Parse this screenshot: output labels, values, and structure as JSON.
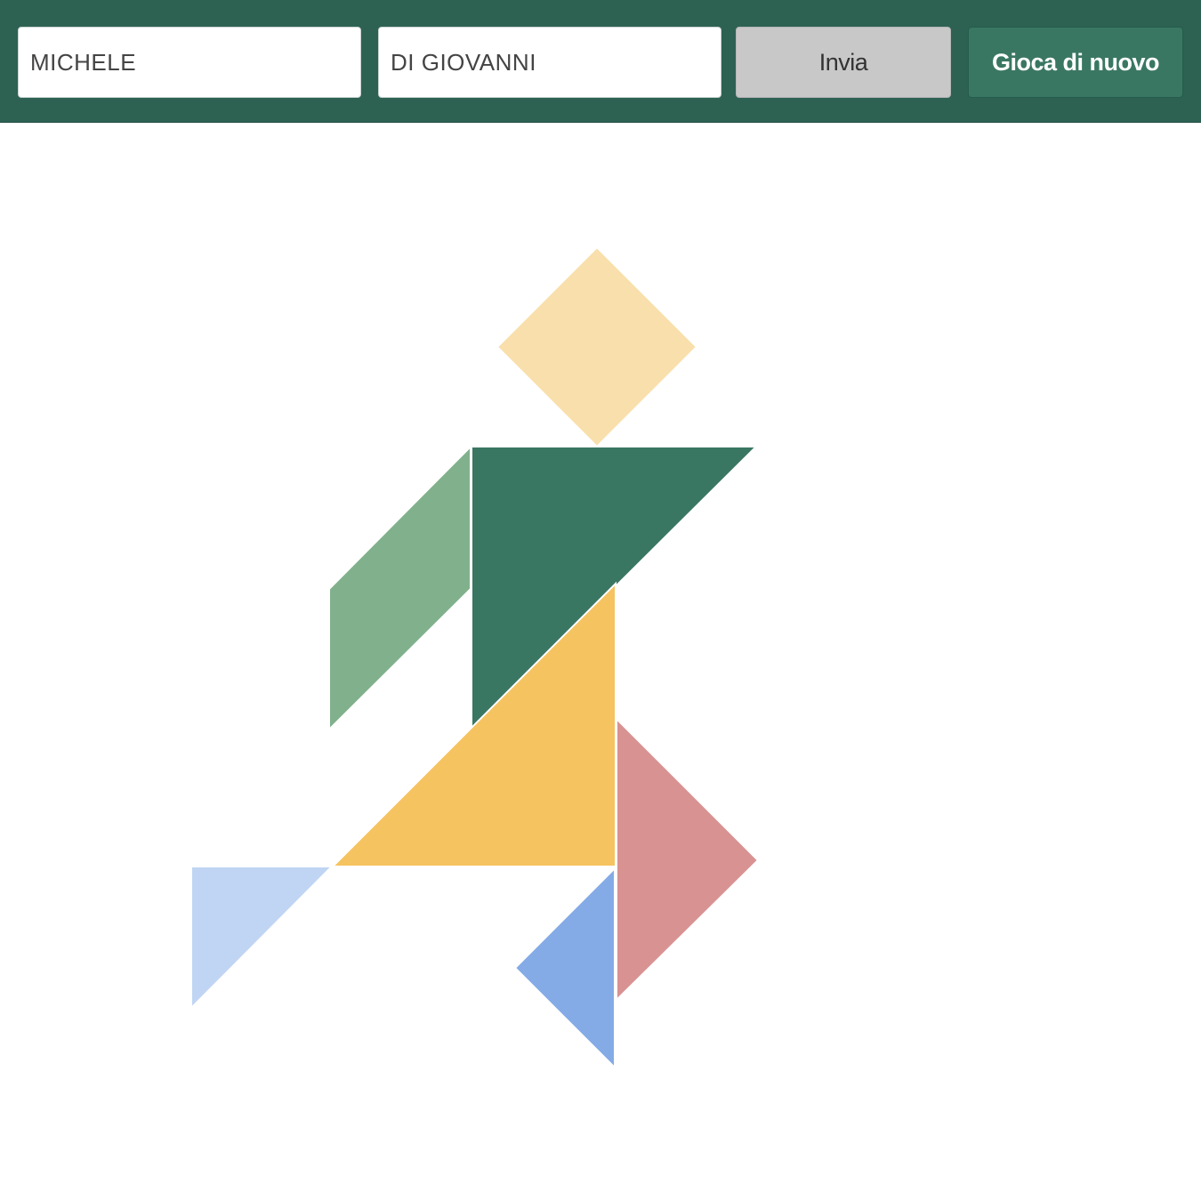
{
  "form": {
    "first_name_value": "MICHELE",
    "last_name_value": "DI GIOVANNI",
    "submit_label": "Invia",
    "replay_label": "Gioca di nuovo"
  },
  "theme": {
    "header_bg": "#2d6253",
    "submit_bg": "#c8c8c8",
    "replay_bg": "#3a7763"
  },
  "tangram": {
    "pieces": [
      {
        "name": "square-piece",
        "color": "#f8dfab"
      },
      {
        "name": "parallelogram-piece",
        "color": "#80b18c"
      },
      {
        "name": "large-triangle-dark-green",
        "color": "#3a7763"
      },
      {
        "name": "large-triangle-yellow",
        "color": "#f6c361"
      },
      {
        "name": "medium-triangle-pink",
        "color": "#d99292"
      },
      {
        "name": "small-triangle-light-blue",
        "color": "#c0d5f3"
      },
      {
        "name": "small-triangle-blue",
        "color": "#84abe5"
      }
    ]
  }
}
